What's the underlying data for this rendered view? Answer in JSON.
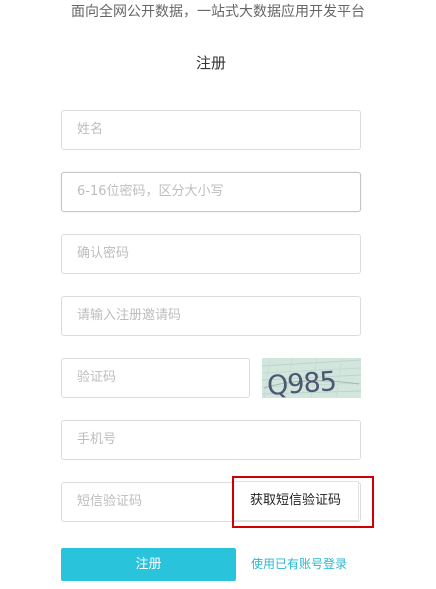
{
  "header": {
    "tagline": "面向全网公开数据，一站式大数据应用开发平台",
    "title": "注册"
  },
  "form": {
    "name_placeholder": "姓名",
    "password_placeholder": "6-16位密码，区分大小写",
    "confirm_password_placeholder": "确认密码",
    "invite_code_placeholder": "请输入注册邀请码",
    "captcha_placeholder": "验证码",
    "captcha_image_text": "Q985",
    "phone_placeholder": "手机号",
    "sms_code_placeholder": "短信验证码",
    "sms_button_label": "获取短信验证码",
    "submit_label": "注册",
    "login_link": "使用已有账号登录"
  },
  "colors": {
    "accent": "#2ac3dc",
    "link": "#2ab7d0",
    "highlight": "#d10000",
    "placeholder": "#bdbdbd",
    "border": "#dcdcdc"
  }
}
